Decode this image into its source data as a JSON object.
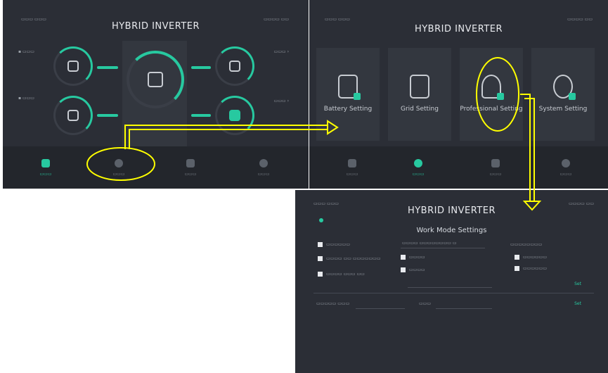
{
  "screen1": {
    "title": "HYBRID INVERTER",
    "nav": [
      {
        "icon": "home-icon",
        "active": true
      },
      {
        "icon": "gear-icon",
        "active": false
      },
      {
        "icon": "calendar-icon",
        "active": false
      },
      {
        "icon": "settings-icon",
        "active": false
      }
    ]
  },
  "screen2": {
    "title": "HYBRID INVERTER",
    "cards": [
      {
        "label": "Battery Setting",
        "icon": "battery-icon"
      },
      {
        "label": "Grid Setting",
        "icon": "grid-tower-icon"
      },
      {
        "label": "Professional Setting",
        "icon": "engineer-icon"
      },
      {
        "label": "System Setting",
        "icon": "gear-icon"
      }
    ],
    "nav": [
      {
        "icon": "home-icon",
        "active": false
      },
      {
        "icon": "gear-icon",
        "active": true
      },
      {
        "icon": "calendar-icon",
        "active": false
      },
      {
        "icon": "settings-icon",
        "active": false
      }
    ]
  },
  "screen3": {
    "title": "HYBRID INVERTER",
    "section_title": "Work Mode Settings",
    "set_label": "Set"
  },
  "colors": {
    "panel_bg": "#2b2e36",
    "accent": "#27c9a0",
    "annotation": "#ffff00"
  }
}
